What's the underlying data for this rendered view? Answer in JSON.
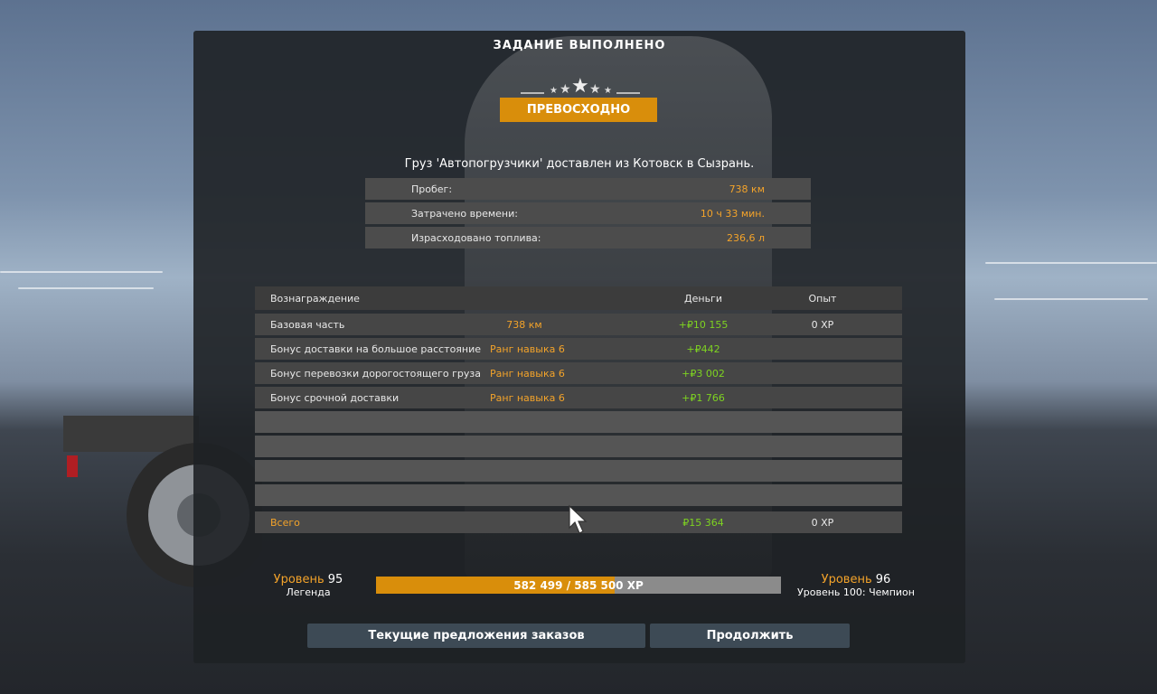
{
  "panel": {
    "title": "ЗАДАНИЕ ВЫПОЛНЕНО",
    "rating_label": "ПРЕВОСХОДНО",
    "delivery_text": "Груз 'Автопогрузчики' доставлен из Котовск в Сызрань."
  },
  "stats": [
    {
      "label": "Пробег:",
      "value": "738 км"
    },
    {
      "label": "Затрачено времени:",
      "value": "10 ч 33 мин."
    },
    {
      "label": "Израсходовано топлива:",
      "value": "236,6 л"
    }
  ],
  "rewards": {
    "headers": {
      "reward": "Вознаграждение",
      "money": "Деньги",
      "xp": "Опыт"
    },
    "rows": [
      {
        "name": "Базовая часть",
        "detail": "738 км",
        "money": "+₽10 155",
        "xp": "0 XP"
      },
      {
        "name": "Бонус доставки на большое расстояние",
        "detail": "Ранг навыка 6",
        "money": "+₽442",
        "xp": ""
      },
      {
        "name": "Бонус перевозки дорогостоящего груза",
        "detail": "Ранг навыка 6",
        "money": "+₽3 002",
        "xp": ""
      },
      {
        "name": "Бонус срочной доставки",
        "detail": "Ранг навыка 6",
        "money": "+₽1 766",
        "xp": ""
      }
    ],
    "total": {
      "label": "Всего",
      "money": "₽15 364",
      "xp": "0 XP"
    }
  },
  "level": {
    "current_word": "Уровень",
    "current_num": "95",
    "current_title": "Легенда",
    "next_word": "Уровень",
    "next_num": "96",
    "next_title": "Уровень 100: Чемпион",
    "xp_text": "582 499 / 585 500 XP",
    "xp_fraction": 0.59
  },
  "buttons": {
    "offers": "Текущие предложения заказов",
    "continue": "Продолжить"
  },
  "colors": {
    "accent": "#d98e0b",
    "money_green": "#7ed321",
    "value_orange": "#f3a32a"
  }
}
